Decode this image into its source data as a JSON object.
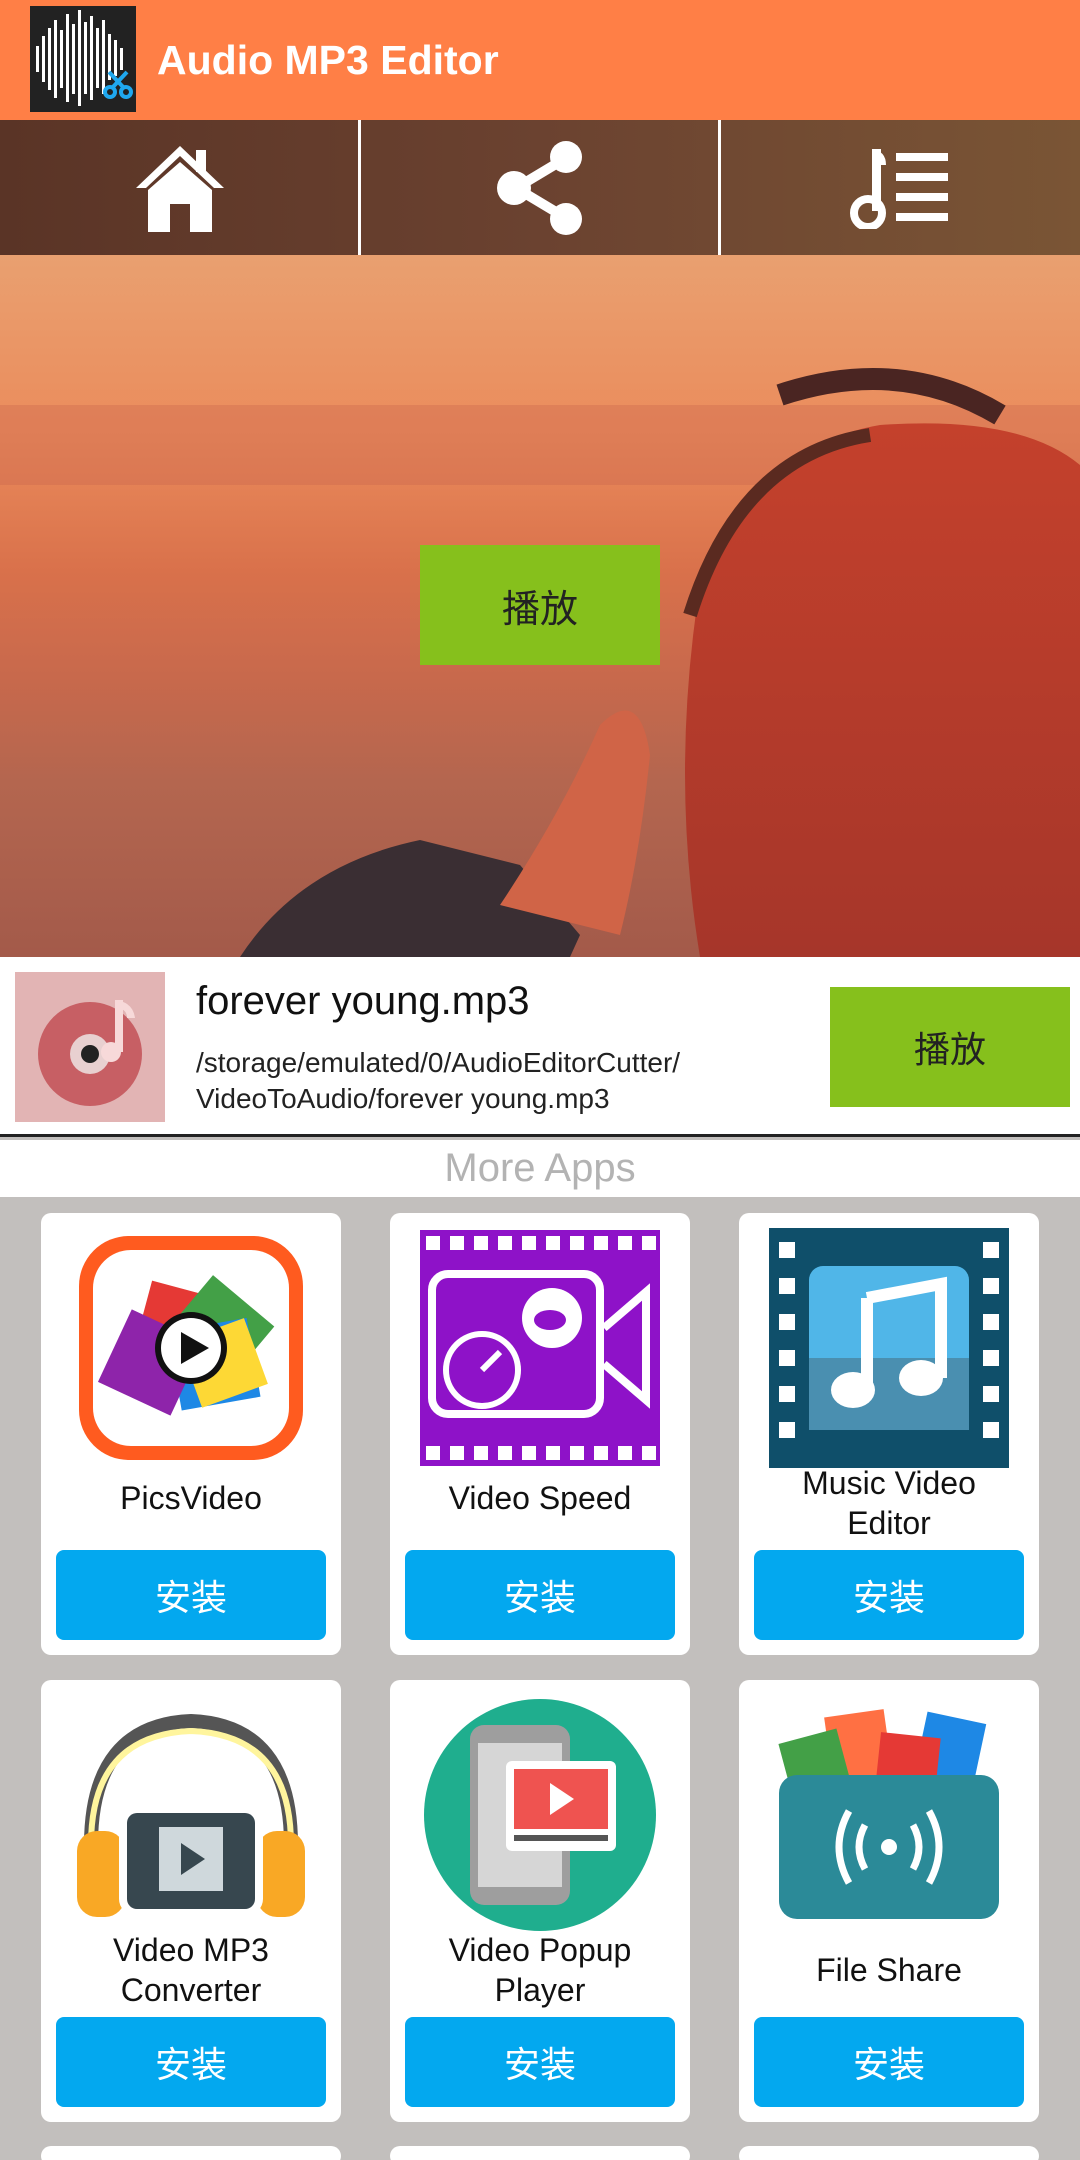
{
  "app": {
    "title": "Audio MP3 Editor"
  },
  "nav": [
    {
      "icon": "home-icon"
    },
    {
      "icon": "share-icon"
    },
    {
      "icon": "playlist-icon"
    }
  ],
  "hero": {
    "play_label": "播放"
  },
  "now_playing": {
    "title": "forever young.mp3",
    "path_line1": "/storage/emulated/0/AudioEditorCutter/",
    "path_line2": "VideoToAudio/forever young.mp3",
    "play_label": "播放"
  },
  "more_apps": {
    "header": "More Apps",
    "install_label": "安装",
    "items": [
      {
        "name": "PicsVideo"
      },
      {
        "name": "Video Speed"
      },
      {
        "name1": "Music Video",
        "name2": "Editor"
      },
      {
        "name1": "Video MP3",
        "name2": "Converter"
      },
      {
        "name1": "Video Popup",
        "name2": "Player"
      },
      {
        "name": "File Share"
      }
    ]
  },
  "colors": {
    "appbar": "#ff7f46",
    "play": "#86c01c",
    "install": "#03a8ef"
  }
}
